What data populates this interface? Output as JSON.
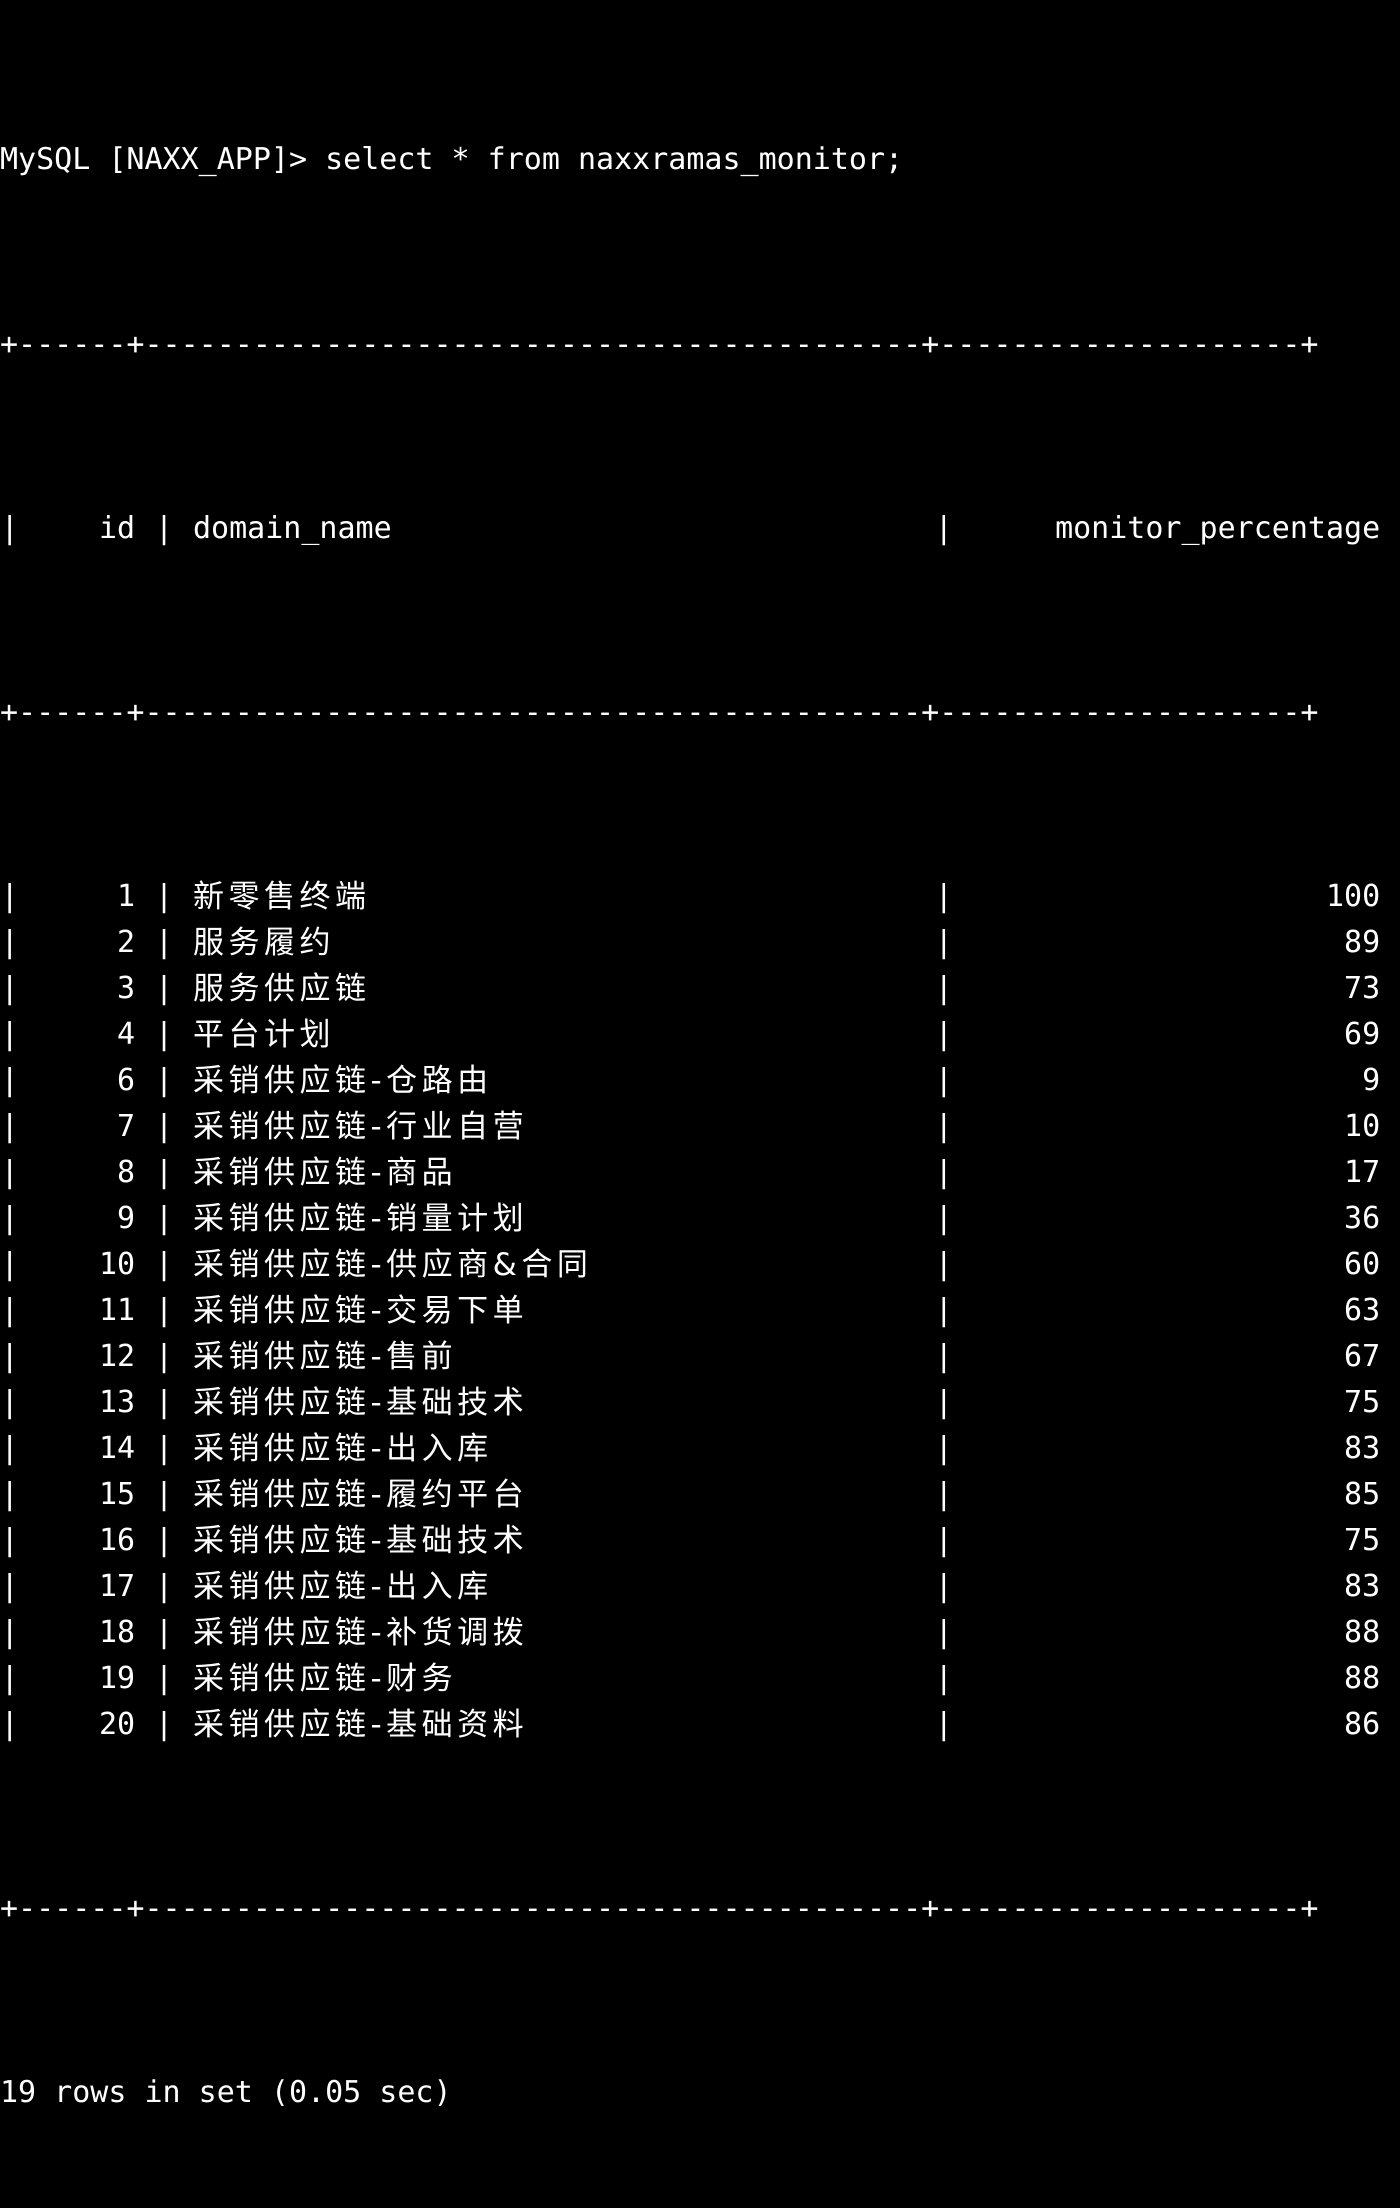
{
  "terminal": {
    "prompt": "MySQL [NAXX_APP]> select * from naxxramas_monitor;",
    "prompt_prefix": "MySQL [NAXX_APP]>",
    "command": "select * from naxxramas_monitor;",
    "separator_top": "+------+-------------------------------------------+--------------------+",
    "separator_header": "+------+-------------------------------------------+--------------------+",
    "separator_bottom": "+------+-------------------------------------------+--------------------+",
    "status": "19 rows in set (0.05 sec)",
    "background_color": "#000000",
    "foreground_color": "#ffffff"
  },
  "table": {
    "columns": [
      "id",
      "domain_name",
      "monitor_percentage"
    ],
    "rows": [
      {
        "id": "1",
        "domain_name": "新零售终端",
        "monitor_percentage": "100"
      },
      {
        "id": "2",
        "domain_name": "服务履约",
        "monitor_percentage": "89"
      },
      {
        "id": "3",
        "domain_name": "服务供应链",
        "monitor_percentage": "73"
      },
      {
        "id": "4",
        "domain_name": "平台计划",
        "monitor_percentage": "69"
      },
      {
        "id": "6",
        "domain_name": "采销供应链-仓路由",
        "monitor_percentage": "9"
      },
      {
        "id": "7",
        "domain_name": "采销供应链-行业自营",
        "monitor_percentage": "10"
      },
      {
        "id": "8",
        "domain_name": "采销供应链-商品",
        "monitor_percentage": "17"
      },
      {
        "id": "9",
        "domain_name": "采销供应链-销量计划",
        "monitor_percentage": "36"
      },
      {
        "id": "10",
        "domain_name": "采销供应链-供应商&合同",
        "monitor_percentage": "60"
      },
      {
        "id": "11",
        "domain_name": "采销供应链-交易下单",
        "monitor_percentage": "63"
      },
      {
        "id": "12",
        "domain_name": "采销供应链-售前",
        "monitor_percentage": "67"
      },
      {
        "id": "13",
        "domain_name": "采销供应链-基础技术",
        "monitor_percentage": "75"
      },
      {
        "id": "14",
        "domain_name": "采销供应链-出入库",
        "monitor_percentage": "83"
      },
      {
        "id": "15",
        "domain_name": "采销供应链-履约平台",
        "monitor_percentage": "85"
      },
      {
        "id": "16",
        "domain_name": "采销供应链-基础技术",
        "monitor_percentage": "75"
      },
      {
        "id": "17",
        "domain_name": "采销供应链-出入库",
        "monitor_percentage": "83"
      },
      {
        "id": "18",
        "domain_name": "采销供应链-补货调拨",
        "monitor_percentage": "88"
      },
      {
        "id": "19",
        "domain_name": "采销供应链-财务",
        "monitor_percentage": "88"
      },
      {
        "id": "20",
        "domain_name": "采销供应链-基础资料",
        "monitor_percentage": "86"
      }
    ]
  }
}
